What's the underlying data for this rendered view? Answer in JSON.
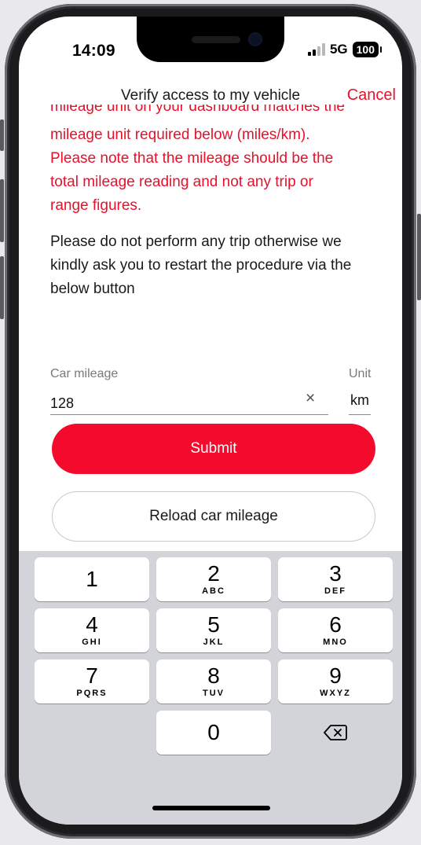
{
  "status_bar": {
    "time": "14:09",
    "network": "5G",
    "battery": "100"
  },
  "nav": {
    "title": "Verify access to my vehicle",
    "cancel": "Cancel"
  },
  "message": {
    "clipped_line": "mileage unit on your dashboard matches the",
    "red_lines": [
      "mileage unit required below (miles/km).",
      "Please note that the mileage should be the",
      "total mileage reading and not any trip or",
      "range figures."
    ],
    "body_lines": [
      "Please do not perform any trip otherwise we",
      "kindly ask you to restart the procedure via the",
      "below button"
    ]
  },
  "form": {
    "mileage_label": "Car mileage",
    "mileage_value": "128",
    "unit_label": "Unit",
    "unit_value": "km",
    "clear_symbol": "×"
  },
  "buttons": {
    "submit": "Submit",
    "reload": "Reload car mileage"
  },
  "keypad": {
    "keys": [
      {
        "num": "1",
        "letters": ""
      },
      {
        "num": "2",
        "letters": "ABC"
      },
      {
        "num": "3",
        "letters": "DEF"
      },
      {
        "num": "4",
        "letters": "GHI"
      },
      {
        "num": "5",
        "letters": "JKL"
      },
      {
        "num": "6",
        "letters": "MNO"
      },
      {
        "num": "7",
        "letters": "PQRS"
      },
      {
        "num": "8",
        "letters": "TUV"
      },
      {
        "num": "9",
        "letters": "WXYZ"
      },
      {
        "num": "0",
        "letters": ""
      }
    ]
  },
  "colors": {
    "accent": "#f40a2d",
    "warning_text": "#e8102a",
    "keyboard_bg": "#d2d4d9"
  }
}
